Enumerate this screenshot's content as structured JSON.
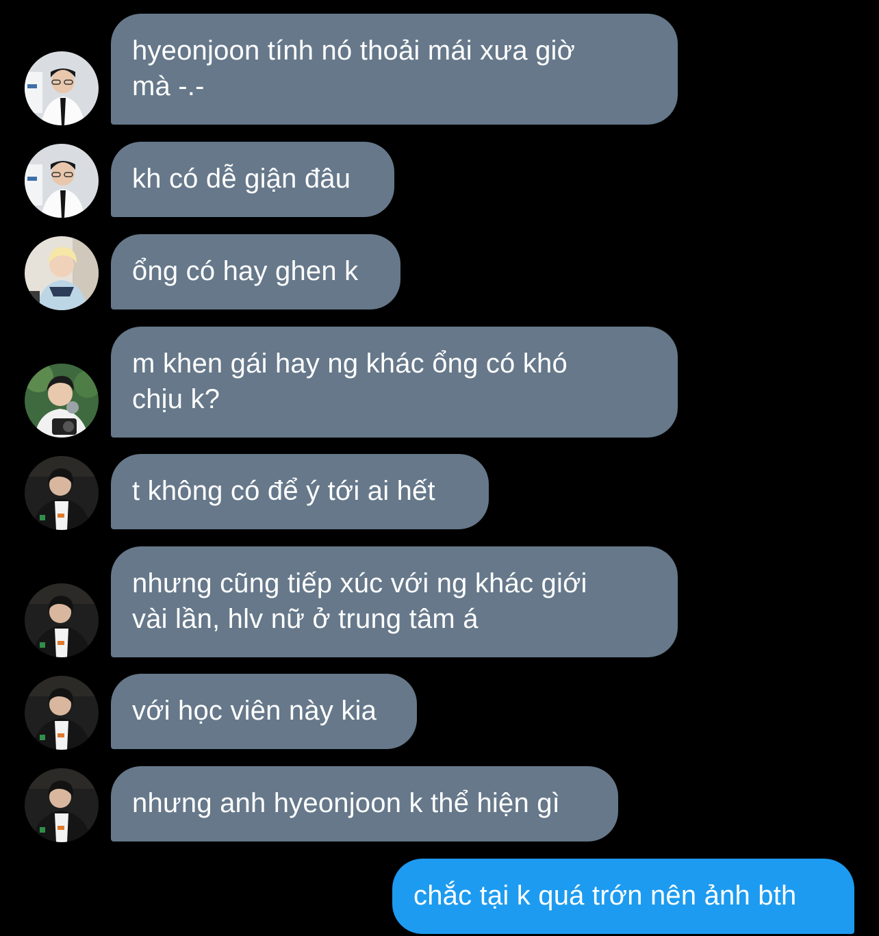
{
  "colors": {
    "background": "#000000",
    "received_bubble": "#66788a",
    "sent_bubble": "#1d9bf0",
    "text": "#ffffff"
  },
  "messages": [
    {
      "direction": "received",
      "avatar": "avatar-suit",
      "text": "hyeonjoon tính nó thoải mái xưa giờ\nmà -.-"
    },
    {
      "direction": "received",
      "avatar": "avatar-suit",
      "text": "kh có dễ giận đâu"
    },
    {
      "direction": "received",
      "avatar": "avatar-blonde",
      "text": "ổng có hay ghen k"
    },
    {
      "direction": "received",
      "avatar": "avatar-camera",
      "text": "m khen gái hay ng khác ổng có khó\nchịu k?"
    },
    {
      "direction": "received",
      "avatar": "avatar-dark",
      "text": "t không có để ý tới ai hết"
    },
    {
      "direction": "received",
      "avatar": "avatar-dark",
      "text": "nhưng cũng tiếp xúc với ng khác giới\nvài lần, hlv nữ ở trung tâm á"
    },
    {
      "direction": "received",
      "avatar": "avatar-dark",
      "text": "với học viên này kia"
    },
    {
      "direction": "received",
      "avatar": "avatar-dark",
      "text": "nhưng anh hyeonjoon k thể hiện gì"
    },
    {
      "direction": "sent",
      "text": "chắc tại k quá trớn nên ảnh bth"
    }
  ]
}
